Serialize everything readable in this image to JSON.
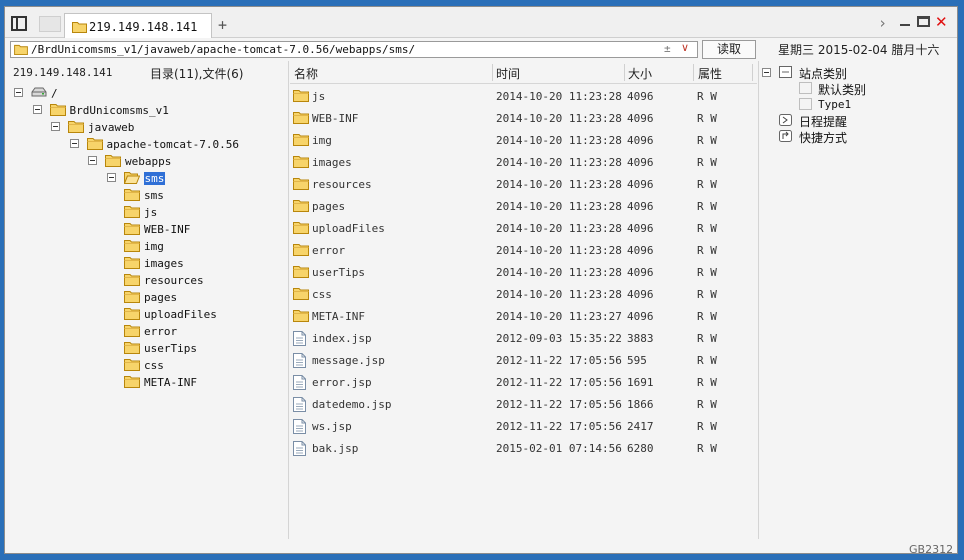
{
  "tabs": {
    "active_label": "219.149.148.141",
    "add_label": "+"
  },
  "window": {
    "close_label": "✕",
    "chevron": "›"
  },
  "pathbar": {
    "path": "/BrdUnicomsms_v1/javaweb/apache-tomcat-7.0.56/webapps/sms/",
    "plusminus": "±",
    "dropdown": "∨"
  },
  "read_button": "读取",
  "date_info": "星期三 2015-02-04 腊月十六",
  "left": {
    "host": "219.149.148.141",
    "summary": "目录(11),文件(6)"
  },
  "tree": [
    {
      "label": "/",
      "icon": "drive-icon"
    },
    {
      "label": "BrdUnicomsms_v1",
      "icon": "folder-icon"
    },
    {
      "label": "javaweb",
      "icon": "folder-icon"
    },
    {
      "label": "apache-tomcat-7.0.56",
      "icon": "folder-icon"
    },
    {
      "label": "webapps",
      "icon": "folder-icon"
    },
    {
      "label": "sms",
      "icon": "folder-open-icon",
      "selected": true
    },
    {
      "label": "sms",
      "icon": "folder-icon"
    },
    {
      "label": "js",
      "icon": "folder-icon"
    },
    {
      "label": "WEB-INF",
      "icon": "folder-icon"
    },
    {
      "label": "img",
      "icon": "folder-icon"
    },
    {
      "label": "images",
      "icon": "folder-icon"
    },
    {
      "label": "resources",
      "icon": "folder-icon"
    },
    {
      "label": "pages",
      "icon": "folder-icon"
    },
    {
      "label": "uploadFiles",
      "icon": "folder-icon"
    },
    {
      "label": "error",
      "icon": "folder-icon"
    },
    {
      "label": "userTips",
      "icon": "folder-icon"
    },
    {
      "label": "css",
      "icon": "folder-icon"
    },
    {
      "label": "META-INF",
      "icon": "folder-icon"
    }
  ],
  "filelist": {
    "headers": {
      "name": "名称",
      "time": "时间",
      "size": "大小",
      "attr": "属性"
    },
    "rows": [
      {
        "name": "js",
        "time": "2014-10-20 11:23:28",
        "size": "4096",
        "attr": "R W",
        "type": "folder"
      },
      {
        "name": "WEB-INF",
        "time": "2014-10-20 11:23:28",
        "size": "4096",
        "attr": "R W",
        "type": "folder"
      },
      {
        "name": "img",
        "time": "2014-10-20 11:23:28",
        "size": "4096",
        "attr": "R W",
        "type": "folder"
      },
      {
        "name": "images",
        "time": "2014-10-20 11:23:28",
        "size": "4096",
        "attr": "R W",
        "type": "folder"
      },
      {
        "name": "resources",
        "time": "2014-10-20 11:23:28",
        "size": "4096",
        "attr": "R W",
        "type": "folder"
      },
      {
        "name": "pages",
        "time": "2014-10-20 11:23:28",
        "size": "4096",
        "attr": "R W",
        "type": "folder"
      },
      {
        "name": "uploadFiles",
        "time": "2014-10-20 11:23:28",
        "size": "4096",
        "attr": "R W",
        "type": "folder"
      },
      {
        "name": "error",
        "time": "2014-10-20 11:23:28",
        "size": "4096",
        "attr": "R W",
        "type": "folder"
      },
      {
        "name": "userTips",
        "time": "2014-10-20 11:23:28",
        "size": "4096",
        "attr": "R W",
        "type": "folder"
      },
      {
        "name": "css",
        "time": "2014-10-20 11:23:28",
        "size": "4096",
        "attr": "R W",
        "type": "folder"
      },
      {
        "name": "META-INF",
        "time": "2014-10-20 11:23:27",
        "size": "4096",
        "attr": "R W",
        "type": "folder"
      },
      {
        "name": "index.jsp",
        "time": "2012-09-03 15:35:22",
        "size": "3883",
        "attr": "R W",
        "type": "file"
      },
      {
        "name": "message.jsp",
        "time": "2012-11-22 17:05:56",
        "size": "595",
        "attr": "R W",
        "type": "file"
      },
      {
        "name": "error.jsp",
        "time": "2012-11-22 17:05:56",
        "size": "1691",
        "attr": "R W",
        "type": "file"
      },
      {
        "name": "datedemo.jsp",
        "time": "2012-11-22 17:05:56",
        "size": "1866",
        "attr": "R W",
        "type": "file"
      },
      {
        "name": "ws.jsp",
        "time": "2012-11-22 17:05:56",
        "size": "2417",
        "attr": "R W",
        "type": "file"
      },
      {
        "name": "bak.jsp",
        "time": "2015-02-01 07:14:56",
        "size": "6280",
        "attr": "R W",
        "type": "file"
      }
    ]
  },
  "sites": {
    "category": "站点类别",
    "default_category": "默认类别",
    "type1": "Type1",
    "schedule": "日程提醒",
    "shortcut": "快捷方式"
  },
  "watermark": "GB2312"
}
